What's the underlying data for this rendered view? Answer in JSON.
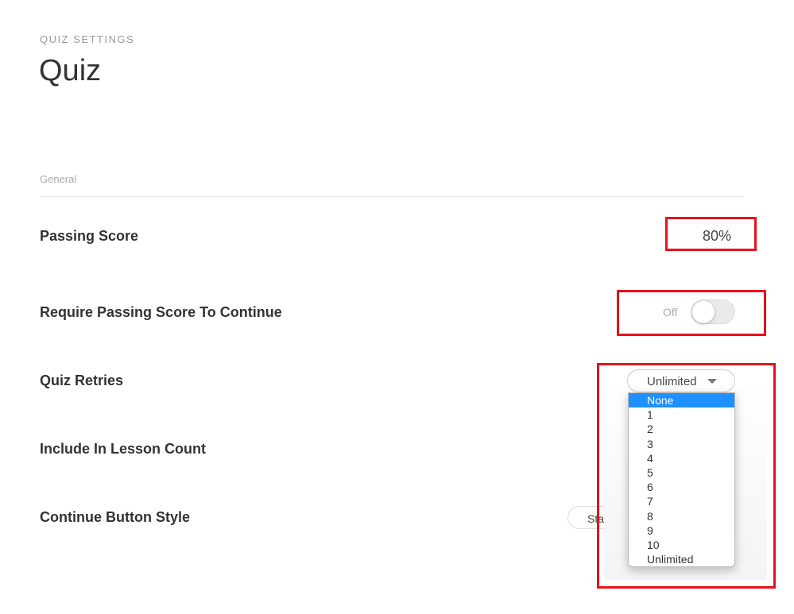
{
  "header": {
    "eyebrow": "QUIZ SETTINGS",
    "title": "Quiz"
  },
  "section": "General",
  "settings": {
    "passing_score": {
      "label": "Passing Score",
      "value": "80%"
    },
    "require_passing": {
      "label": "Require Passing Score To Continue",
      "state": "Off"
    },
    "quiz_retries": {
      "label": "Quiz Retries",
      "value": "Unlimited",
      "options": [
        "None",
        "1",
        "2",
        "3",
        "4",
        "5",
        "6",
        "7",
        "8",
        "9",
        "10",
        "Unlimited"
      ],
      "highlighted": "None"
    },
    "lesson_count": {
      "label": "Include In Lesson Count"
    },
    "continue_style": {
      "label": "Continue Button Style",
      "value": "Standard"
    }
  },
  "colors": {
    "highlight": "#1e90ff",
    "annotation": "#e8111b"
  }
}
